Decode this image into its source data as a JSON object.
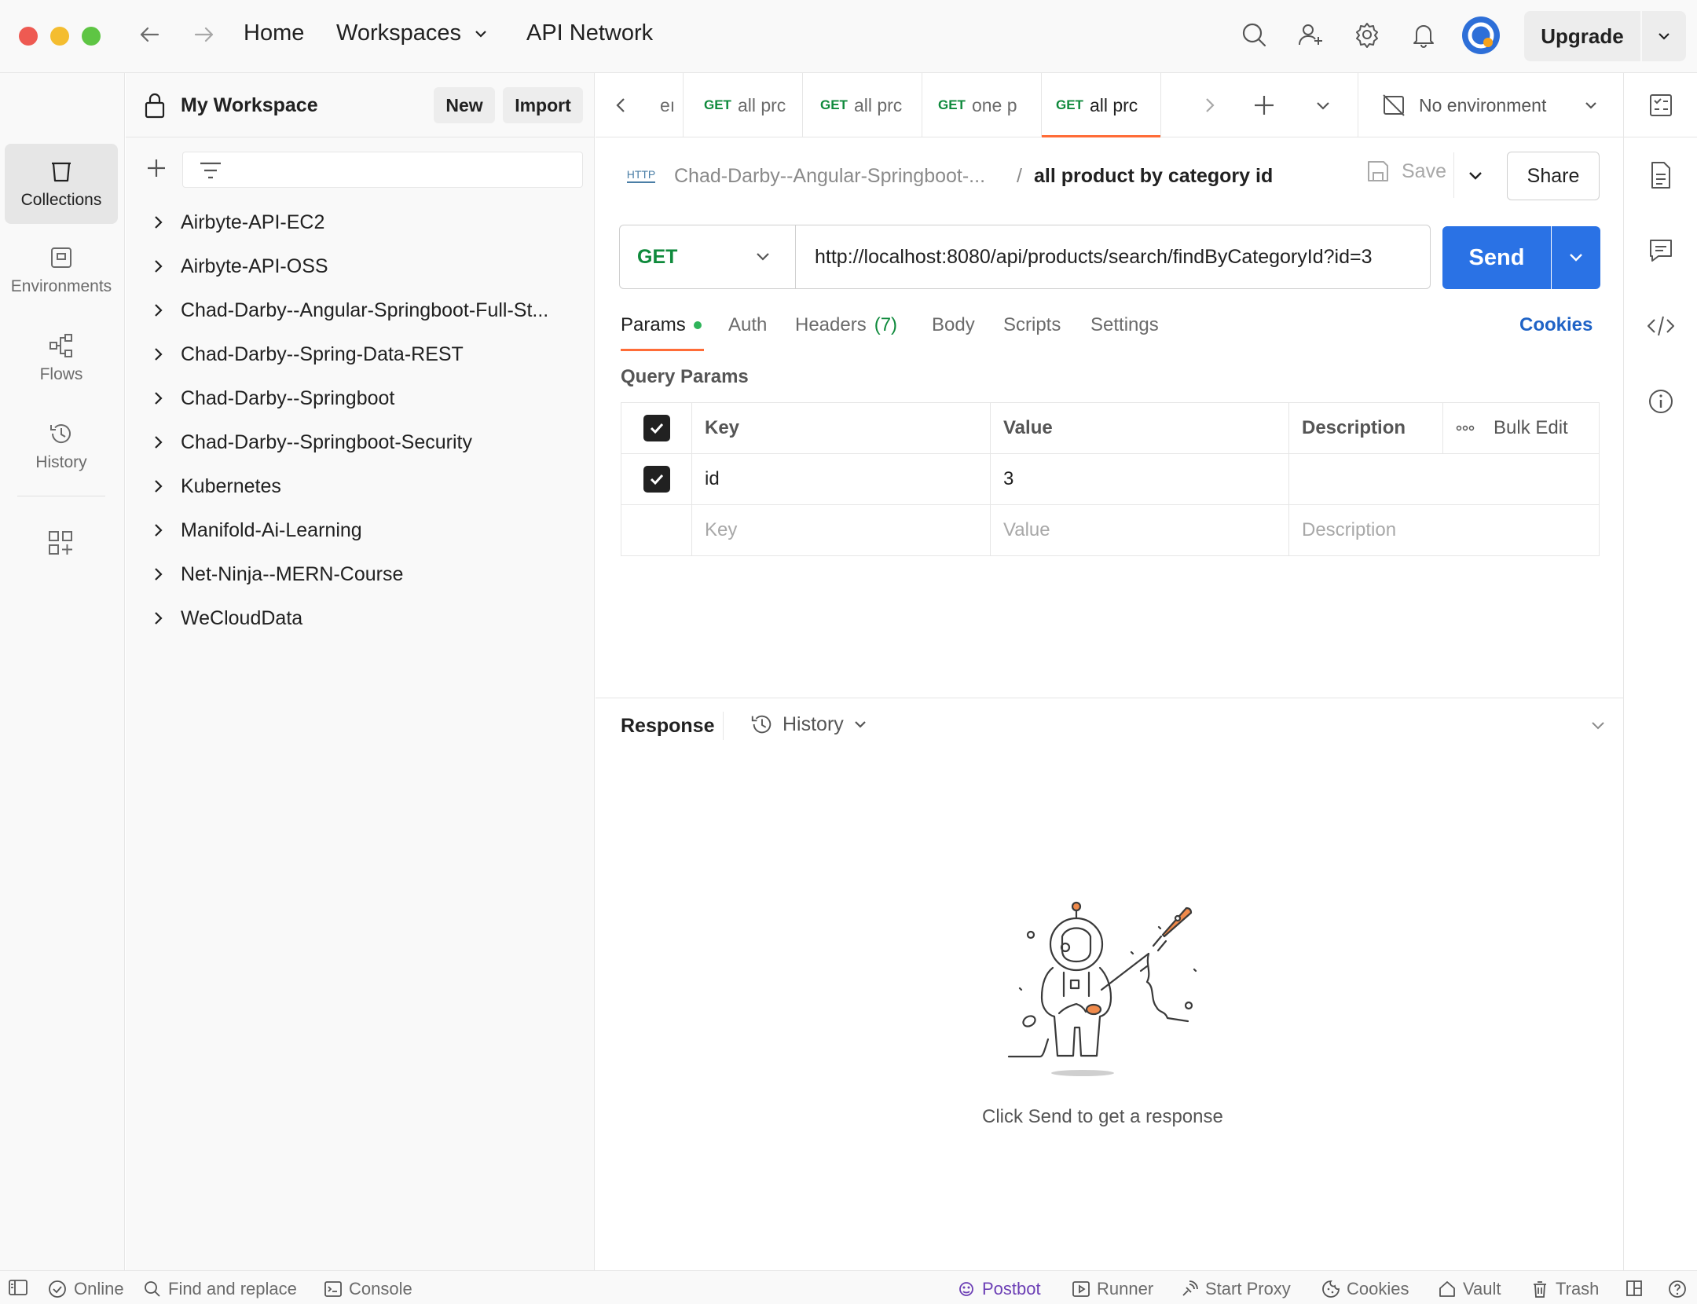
{
  "titlebar": {
    "home": "Home",
    "workspaces": "Workspaces",
    "api_network": "API Network",
    "upgrade": "Upgrade"
  },
  "rail": {
    "collections": "Collections",
    "environments": "Environments",
    "flows": "Flows",
    "history": "History"
  },
  "sidebar": {
    "workspace_name": "My Workspace",
    "new_label": "New",
    "import_label": "Import",
    "collections": [
      "Airbyte-API-EC2",
      "Airbyte-API-OSS",
      "Chad-Darby--Angular-Springboot-Full-St...",
      "Chad-Darby--Spring-Data-REST",
      "Chad-Darby--Springboot",
      "Chad-Darby--Springboot-Security",
      "Kubernetes",
      "Manifold-Ai-Learning",
      "Net-Ninja--MERN-Course",
      "WeCloudData"
    ]
  },
  "tabs": {
    "items": [
      {
        "method": "",
        "label": "eı"
      },
      {
        "method": "GET",
        "label": "all prc"
      },
      {
        "method": "GET",
        "label": "all prc"
      },
      {
        "method": "GET",
        "label": "one p"
      },
      {
        "method": "GET",
        "label": "all prc"
      }
    ],
    "environment": "No environment"
  },
  "request": {
    "breadcrumb_parent": "Chad-Darby--Angular-Springboot-...",
    "separator": "/",
    "name": "all product by category id",
    "save_label": "Save",
    "share_label": "Share",
    "method": "GET",
    "url": "http://localhost:8080/api/products/search/findByCategoryId?id=3",
    "send_label": "Send",
    "http_badge": "HTTP"
  },
  "request_tabs": {
    "params": "Params",
    "auth": "Auth",
    "headers": "Headers",
    "headers_count": "(7)",
    "body": "Body",
    "scripts": "Scripts",
    "settings": "Settings",
    "cookies": "Cookies"
  },
  "query_params": {
    "title": "Query Params",
    "headers": {
      "key": "Key",
      "value": "Value",
      "description": "Description",
      "bulk_edit": "Bulk Edit"
    },
    "rows": [
      {
        "key": "id",
        "value": "3",
        "description": ""
      }
    ],
    "placeholders": {
      "key": "Key",
      "value": "Value",
      "description": "Description"
    }
  },
  "response": {
    "title": "Response",
    "history": "History",
    "empty_message": "Click Send to get a response"
  },
  "statusbar": {
    "online": "Online",
    "find_replace": "Find and replace",
    "console": "Console",
    "postbot": "Postbot",
    "runner": "Runner",
    "start_proxy": "Start Proxy",
    "cookies": "Cookies",
    "vault": "Vault",
    "trash": "Trash"
  },
  "colors": {
    "accent": "#ff6c37",
    "send": "#2a72e5",
    "get": "#0f8a3c",
    "cookies_link": "#1f63c6",
    "postbot": "#6c3fb5"
  }
}
